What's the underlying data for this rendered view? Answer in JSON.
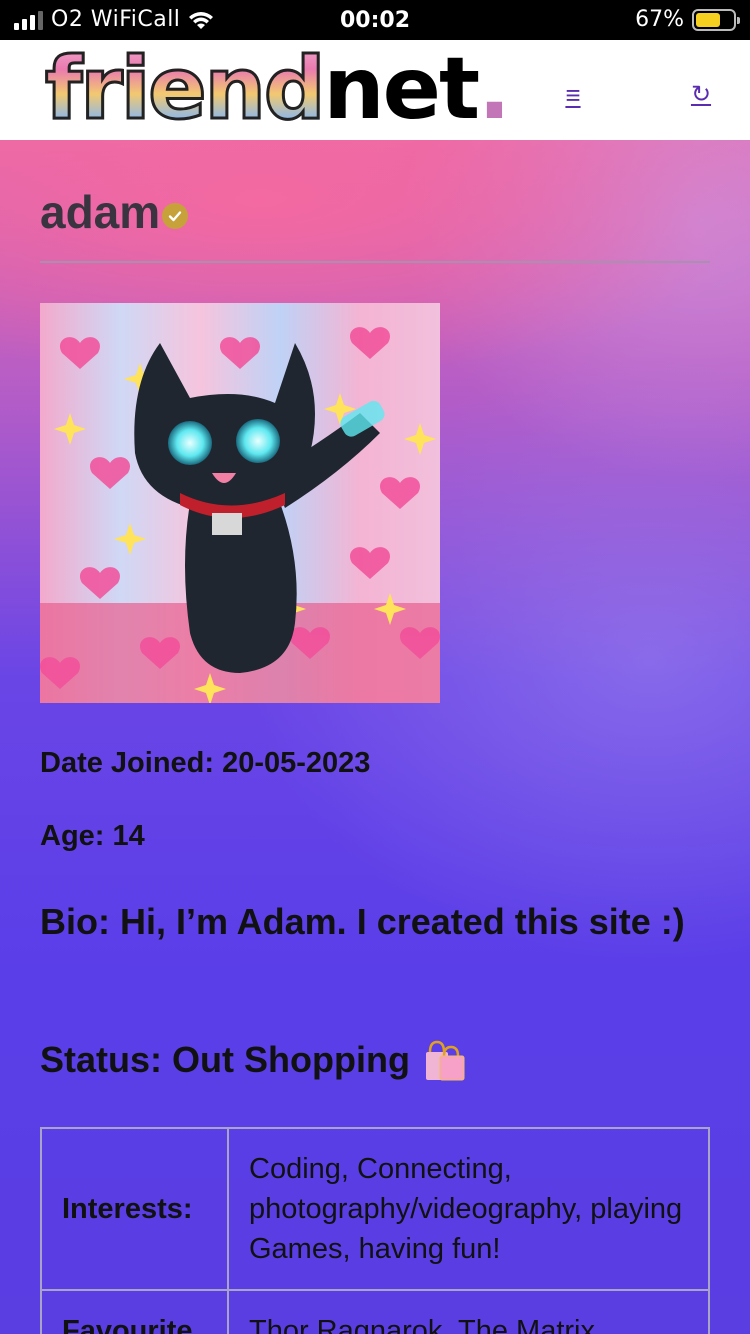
{
  "status_bar": {
    "carrier": "O2 WiFiCall",
    "time": "00:02",
    "battery": "67%",
    "battery_level": 0.67
  },
  "header": {
    "logo_part1": "friend",
    "logo_part2": "net",
    "logo_dot": ".",
    "menu_icon": "≡",
    "refresh_icon": "↻"
  },
  "profile": {
    "username": "adam",
    "date_joined": "Date Joined: 20-05-2023",
    "age": "Age: 14",
    "bio": "Bio: Hi, I’m Adam. I created this site :)",
    "status": "Status: Out Shopping"
  },
  "table": {
    "rows": [
      {
        "label": "Interests:",
        "value": "Coding, Connecting, photography/videography, playing Games, having fun!"
      },
      {
        "label": "Favourite",
        "value": "Thor Ragnarok, The Matrix"
      }
    ]
  },
  "colors": {
    "accent": "#5a2db0",
    "verified": "#c7a13a",
    "battery": "#f5d020"
  }
}
